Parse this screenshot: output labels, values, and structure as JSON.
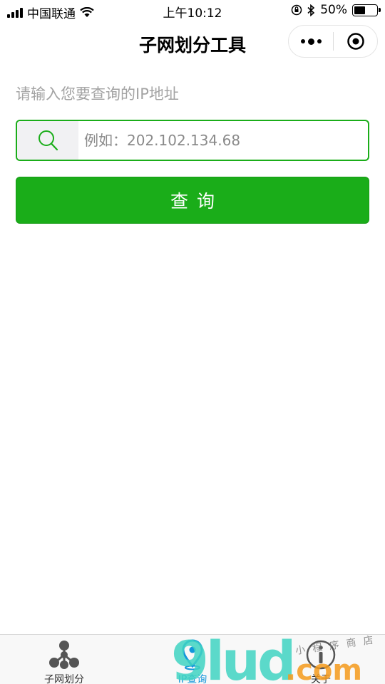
{
  "status_bar": {
    "carrier": "中国联通",
    "time": "上午10:12",
    "battery_percent": "50%",
    "battery_level": 0.5
  },
  "nav": {
    "title": "子网划分工具"
  },
  "form": {
    "hint": "请输入您要查询的IP地址",
    "input_placeholder": "例如：202.102.134.68",
    "input_value": "",
    "query_button": "查询"
  },
  "tabs": [
    {
      "label": "子网划分",
      "icon": "network-nodes-icon",
      "active": false
    },
    {
      "label": "IP查询",
      "icon": "location-pin-icon",
      "active": true
    },
    {
      "label": "关于",
      "icon": "info-icon",
      "active": false
    }
  ],
  "watermark": {
    "brand": "9lud",
    "domain": ".com",
    "tagline": "小程序商店"
  },
  "colors": {
    "primary_green": "#1aad19",
    "tab_active": "#1296db",
    "hint_gray": "#a3a3a3"
  }
}
